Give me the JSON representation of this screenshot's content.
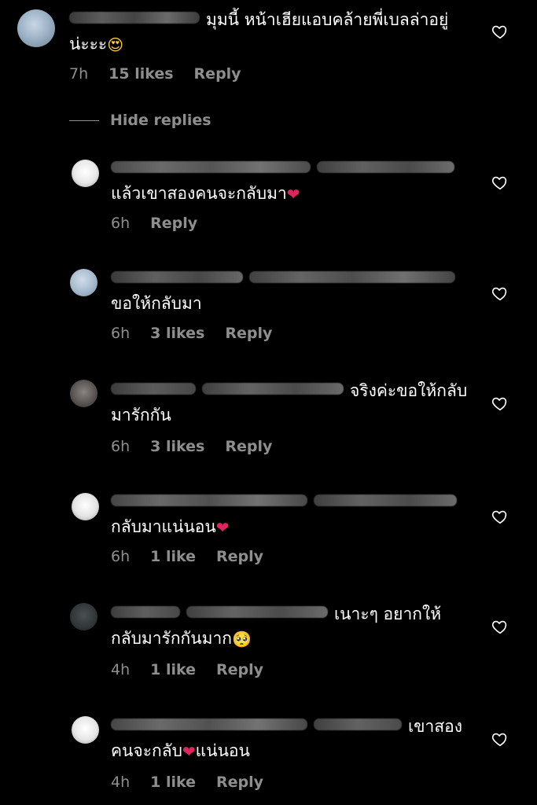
{
  "main_comment": {
    "text": "มุมนี้ หน้าเฮียแอบคล้ายพี่เบลล่าอยู่น่ะะะ",
    "emoji": "😍",
    "time": "7h",
    "likes": "15 likes",
    "reply_label": "Reply"
  },
  "hide_replies_label": "Hide replies",
  "replies": [
    {
      "text": "แล้วเขาสองคนจะกลับมา",
      "emoji": "❤",
      "time": "6h",
      "likes": "",
      "reply_label": "Reply"
    },
    {
      "text": "ขอให้กลับมา",
      "emoji": "",
      "time": "6h",
      "likes": "3 likes",
      "reply_label": "Reply"
    },
    {
      "text": "จริงค่ะขอให้กลับมารักกัน",
      "emoji": "",
      "time": "6h",
      "likes": "3 likes",
      "reply_label": "Reply"
    },
    {
      "text": "กลับมาแน่นอน",
      "emoji": "❤",
      "time": "6h",
      "likes": "1 like",
      "reply_label": "Reply"
    },
    {
      "text": "เนาะๆ อยากให้กลับมารักกันมาก",
      "emoji": "🥺",
      "time": "4h",
      "likes": "1 like",
      "reply_label": "Reply"
    },
    {
      "text": "เขาสองคนจะกลับ",
      "emoji": "❤",
      "text_after": "แน่นอน",
      "time": "4h",
      "likes": "1 like",
      "reply_label": "Reply"
    }
  ],
  "colors": {
    "background": "#000000",
    "text": "#ffffff",
    "meta": "#8e8e8e",
    "heart": "#e0245e"
  },
  "icons": {
    "like": "heart-outline-icon"
  }
}
